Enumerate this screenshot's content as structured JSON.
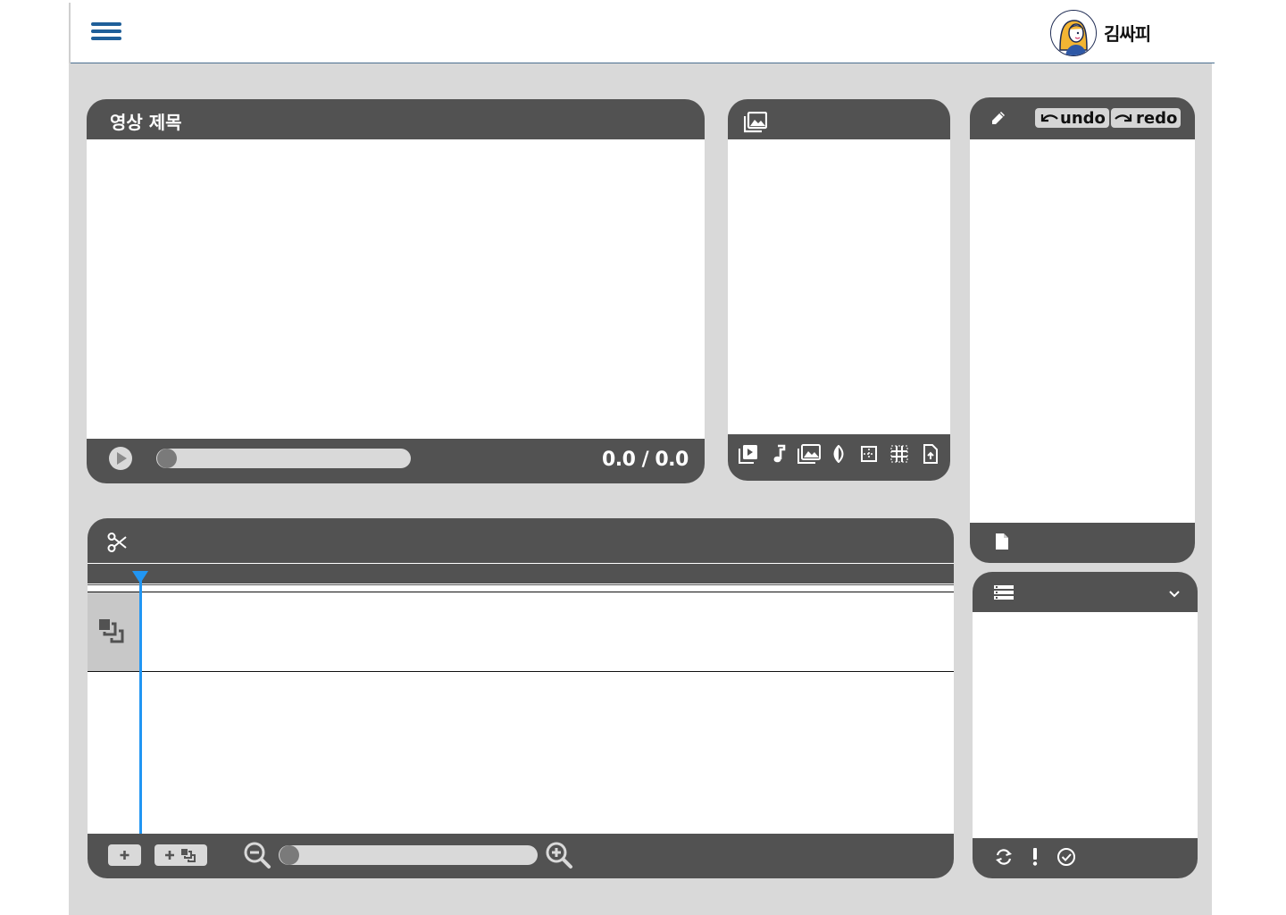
{
  "header": {
    "username": "김싸피",
    "menu_icon": "hamburger-menu-icon",
    "avatar_icon": "user-avatar"
  },
  "video_panel": {
    "title": "영상 제목",
    "time_display": "0.0 / 0.0",
    "progress": 0,
    "play_icon": "play-icon"
  },
  "media_panel": {
    "header_icon": "photo-library-icon",
    "toolbar_icons": [
      "video-library-icon",
      "music-note-icon",
      "image-icon",
      "contrast-icon",
      "grid-box-icon",
      "grid-lines-icon",
      "file-upload-icon"
    ]
  },
  "edit_panel": {
    "header_icon": "pencil-icon",
    "undo_label": "undo",
    "redo_label": "redo",
    "footer_icon": "document-icon"
  },
  "queue_panel": {
    "header_icon": "list-icon",
    "dropdown_icon": "chevron-down-icon",
    "footer_icons": [
      "refresh-icon",
      "exclamation-icon",
      "check-circle-icon"
    ]
  },
  "timeline_panel": {
    "header_icon": "scissors-icon",
    "track_icon": "layers-icon",
    "zoom": 0,
    "add_track_icon": "plus-icon",
    "add_layer_icon": "plus-layers-icon",
    "zoom_out_icon": "zoom-out-icon",
    "zoom_in_icon": "zoom-in-icon"
  },
  "colors": {
    "panel": "#525252",
    "background": "#d9d9d9",
    "accent": "#1f5f99",
    "playhead": "#2196f3"
  }
}
